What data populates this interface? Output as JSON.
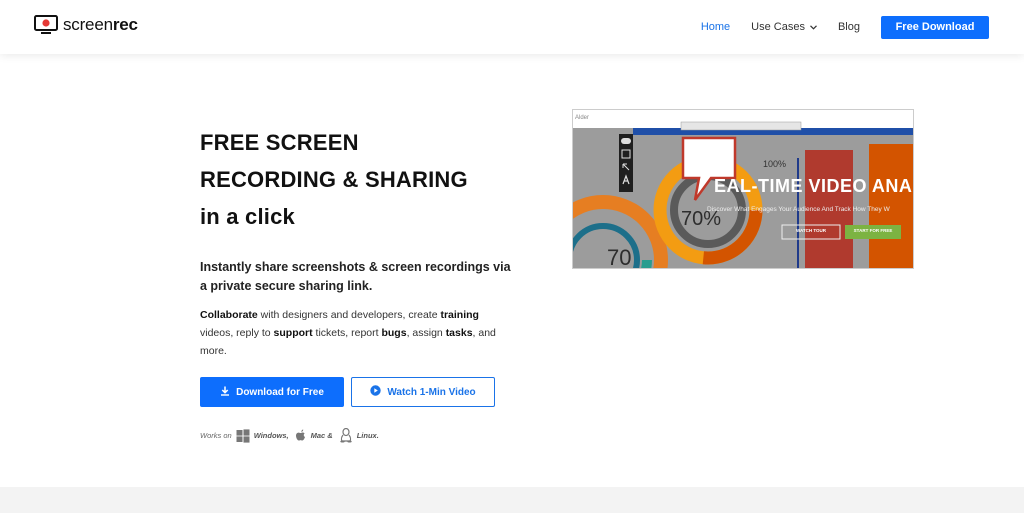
{
  "header": {
    "logo": {
      "text_light": "screen",
      "text_bold": "rec"
    },
    "nav": [
      {
        "label": "Home",
        "active": true
      },
      {
        "label": "Use Cases",
        "dropdown": true
      },
      {
        "label": "Blog"
      }
    ],
    "cta_label": "Free Download"
  },
  "hero": {
    "title_line1": "FREE SCREEN",
    "title_line2": "RECORDING & SHARING",
    "title_line3": "in a click",
    "subtitle": "Instantly share screenshots & screen recordings via a private secure sharing link.",
    "body": {
      "bold1": "Collaborate",
      "t1": " with designers and developers, create ",
      "bold2": "training",
      "t2": " videos, reply to ",
      "bold3": "support",
      "t3": " tickets, report ",
      "bold4": "bugs",
      "t4": ", assign ",
      "bold5": "tasks",
      "t5": ", and more."
    },
    "primary_button": "Download for Free",
    "secondary_button": "Watch 1-Min Video",
    "works_on": {
      "label": "Works on",
      "windows": "Windows,",
      "mac": "Mac &",
      "linux": "Linux."
    }
  },
  "preview": {
    "top_left_text": "Alder",
    "headline": "EAL-TIME VIDEO ANA",
    "subline": "Discover What Engages Your Audience And Track How They W",
    "watch_tour": "WATCH TOUR",
    "start_free": "START FOR FREE",
    "pct_100": "100%",
    "pct_70": "70%",
    "pct_70b": "70"
  },
  "colors": {
    "accent": "#0d6efd",
    "link_active": "#1a73e8",
    "logo_red": "#e53935",
    "preview_green": "#7cb342",
    "preview_red": "#c0392b",
    "preview_orange": "#e67e22"
  }
}
